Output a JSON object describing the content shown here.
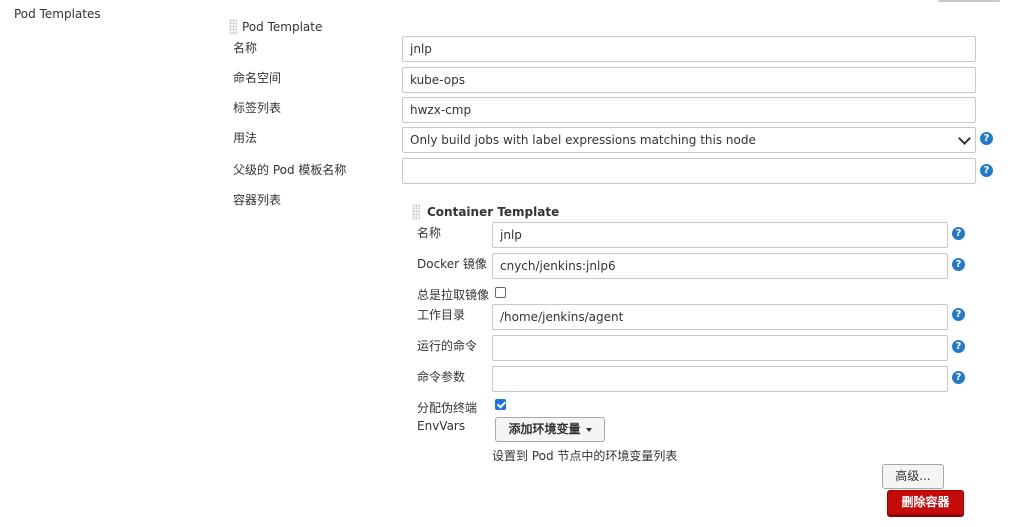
{
  "section": {
    "title": "Pod Templates"
  },
  "pod_template": {
    "header": "Pod Template",
    "name_label": "名称",
    "name_value": "jnlp",
    "namespace_label": "命名空间",
    "namespace_value": "kube-ops",
    "labels_label": "标签列表",
    "labels_value": "hwzx-cmp",
    "usage_label": "用法",
    "usage_value": "Only build jobs with label expressions matching this node",
    "parent_label": "父级的 Pod 模板名称",
    "parent_value": "",
    "containers_label": "容器列表"
  },
  "container_template": {
    "header": "Container Template",
    "name_label": "名称",
    "name_value": "jnlp",
    "image_label": "Docker 镜像",
    "image_value": "cnych/jenkins:jnlp6",
    "always_pull_label": "总是拉取镜像",
    "always_pull_checked": false,
    "workdir_label": "工作目录",
    "workdir_value": "/home/jenkins/agent",
    "command_label": "运行的命令",
    "command_value": "",
    "args_label": "命令参数",
    "args_value": "",
    "tty_label": "分配伪终端",
    "tty_checked": true,
    "envvars_label": "EnvVars",
    "add_env_button": "添加环境变量",
    "envvars_hint": "设置到 Pod 节点中的环境变量列表",
    "advanced_button": "高级...",
    "delete_button": "删除容器"
  },
  "help_glyph": "?"
}
